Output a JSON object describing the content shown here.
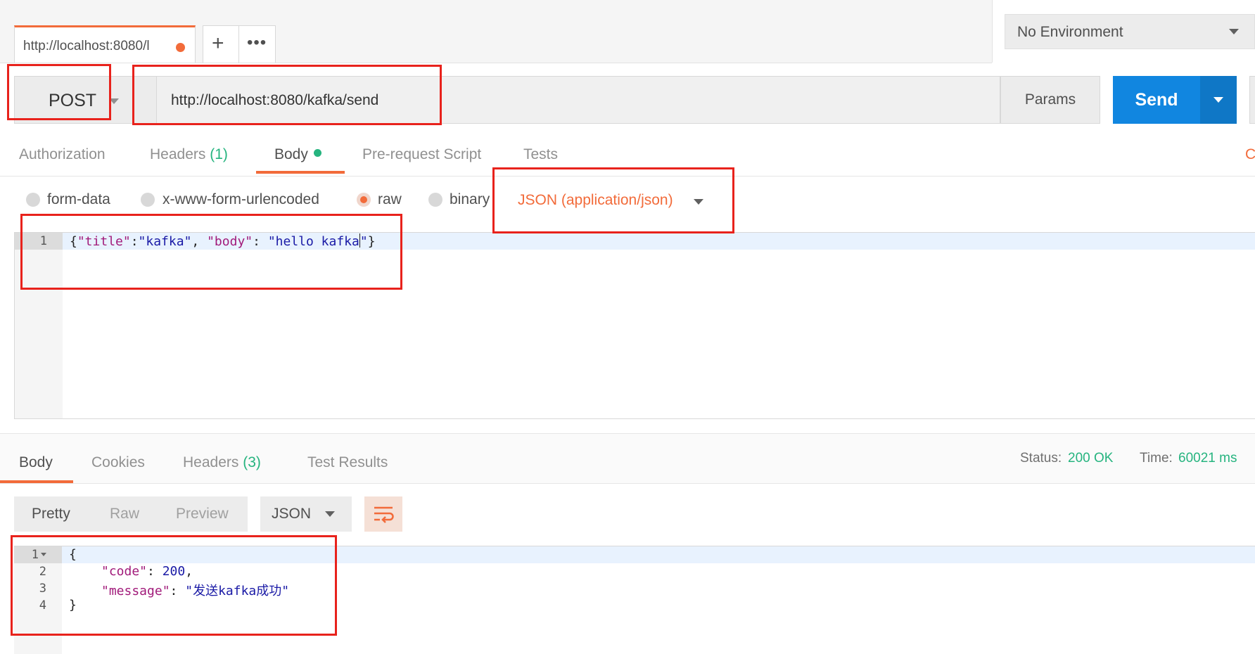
{
  "tabs": {
    "active_tab_label": "http://localhost:8080/l",
    "add_tab_glyph": "+",
    "more_glyph": "•••"
  },
  "environment": {
    "selected": "No Environment"
  },
  "request": {
    "method": "POST",
    "url": "http://localhost:8080/kafka/send",
    "params_label": "Params",
    "send_label": "Send"
  },
  "request_tabs": {
    "authorization": "Authorization",
    "headers": "Headers",
    "headers_count": "(1)",
    "body": "Body",
    "pre_request": "Pre-request Script",
    "tests": "Tests",
    "cookies_stub": "Co"
  },
  "body_types": {
    "form_data": "form-data",
    "urlencoded": "x-www-form-urlencoded",
    "raw": "raw",
    "binary": "binary",
    "content_type": "JSON (application/json)"
  },
  "request_body": {
    "line_number": "1",
    "p1": "{",
    "k1": "\"title\"",
    "p2": ":",
    "v1": "\"kafka\"",
    "p3": ", ",
    "k2": "\"body\"",
    "p4": ": ",
    "v2a": "\"hello kafka",
    "v2b": "\"",
    "p5": "}"
  },
  "response_tabs": {
    "body": "Body",
    "cookies": "Cookies",
    "headers": "Headers",
    "headers_count": "(3)",
    "test_results": "Test Results"
  },
  "response_status": {
    "status_label": "Status:",
    "status_value": "200 OK",
    "time_label": "Time:",
    "time_value": "60021 ms"
  },
  "response_view": {
    "pretty": "Pretty",
    "raw": "Raw",
    "preview": "Preview",
    "format": "JSON"
  },
  "response_body": {
    "lines": [
      "1",
      "2",
      "3",
      "4"
    ],
    "open_brace": "{",
    "code_key": "\"code\"",
    "code_sep": ": ",
    "code_value": "200",
    "code_comma": ",",
    "message_key": "\"message\"",
    "message_sep": ": ",
    "message_value": "\"发送kafka成功\"",
    "close_brace": "}"
  },
  "colors": {
    "accent": "#f26b3a",
    "send_blue": "#1186e0",
    "success_green": "#26b47f",
    "highlight_red": "#e8221c"
  }
}
